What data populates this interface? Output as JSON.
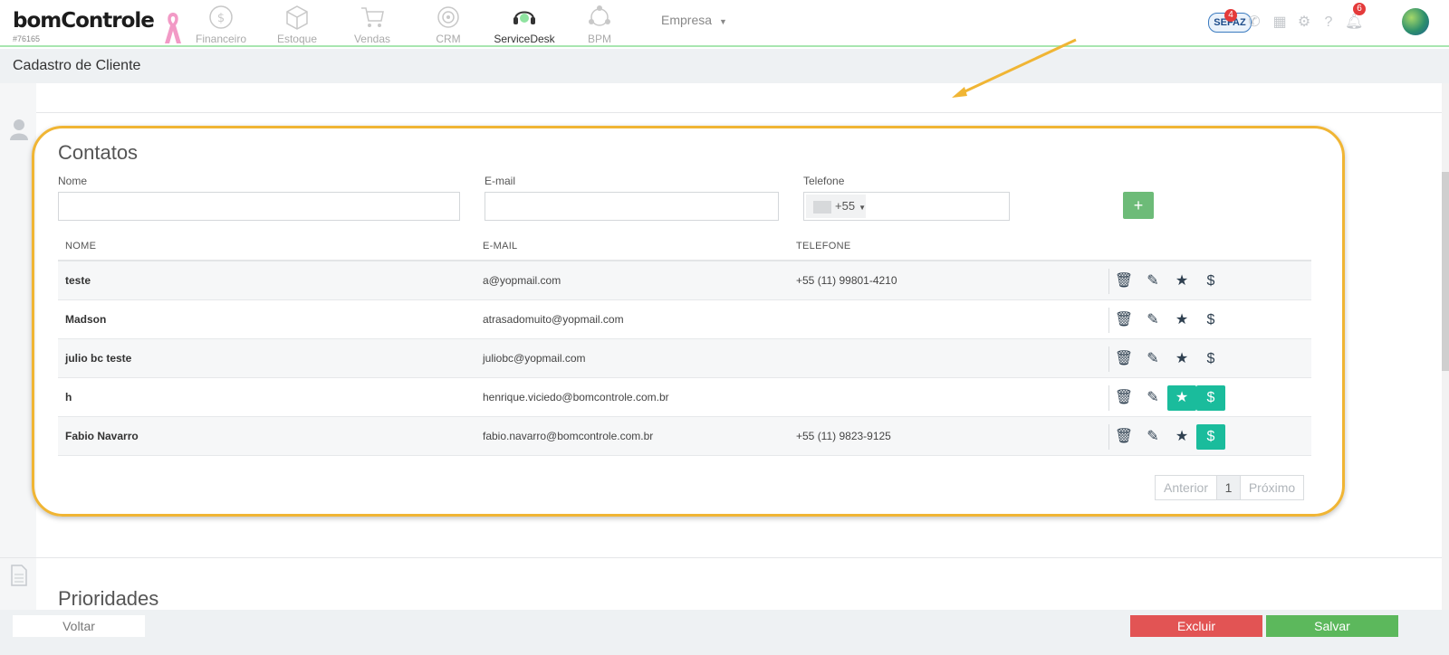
{
  "app": {
    "logo": "bomControle",
    "account_id": "#76165"
  },
  "nav": {
    "items": [
      {
        "label": "Financeiro",
        "icon": "dollar-circle-icon",
        "active": false
      },
      {
        "label": "Estoque",
        "icon": "box-icon",
        "active": false
      },
      {
        "label": "Vendas",
        "icon": "cart-icon",
        "active": false
      },
      {
        "label": "CRM",
        "icon": "target-icon",
        "active": false
      },
      {
        "label": "ServiceDesk",
        "icon": "headset-icon",
        "active": true
      },
      {
        "label": "BPM",
        "icon": "process-icon",
        "active": false
      }
    ],
    "company_menu": "Empresa"
  },
  "header_right": {
    "sefaz_label": "SEFAZ",
    "sefaz_badge": "4",
    "notifications_badge": "6"
  },
  "page": {
    "title": "Cadastro de Cliente"
  },
  "contacts": {
    "section_title": "Contatos",
    "form": {
      "name_label": "Nome",
      "email_label": "E-mail",
      "phone_label": "Telefone",
      "phone_prefix": "+55",
      "add_label": "+"
    },
    "columns": [
      "NOME",
      "E-MAIL",
      "TELEFONE"
    ],
    "rows": [
      {
        "name": "teste",
        "email": "a@yopmail.com",
        "phone": "+55 (11) 99801-4210",
        "favorite": false,
        "billing": false
      },
      {
        "name": "Madson",
        "email": "atrasadomuito@yopmail.com",
        "phone": "",
        "favorite": false,
        "billing": false
      },
      {
        "name": "julio bc teste",
        "email": "juliobc@yopmail.com",
        "phone": "",
        "favorite": false,
        "billing": false
      },
      {
        "name": "h",
        "email": "henrique.viciedo@bomcontrole.com.br",
        "phone": "",
        "favorite": true,
        "billing": true
      },
      {
        "name": "Fabio Navarro",
        "email": "fabio.navarro@bomcontrole.com.br",
        "phone": "+55 (11) 9823-9125",
        "favorite": false,
        "billing": true
      }
    ],
    "pagination": {
      "prev": "Anterior",
      "current": "1",
      "next": "Próximo"
    }
  },
  "priorities": {
    "section_title": "Prioridades"
  },
  "footer": {
    "back_label": "Voltar",
    "delete_label": "Excluir",
    "save_label": "Salvar"
  },
  "colors": {
    "accent_teal": "#1abc9c",
    "highlight": "#f0b534",
    "delete": "#e25454",
    "save": "#5cb85c"
  }
}
